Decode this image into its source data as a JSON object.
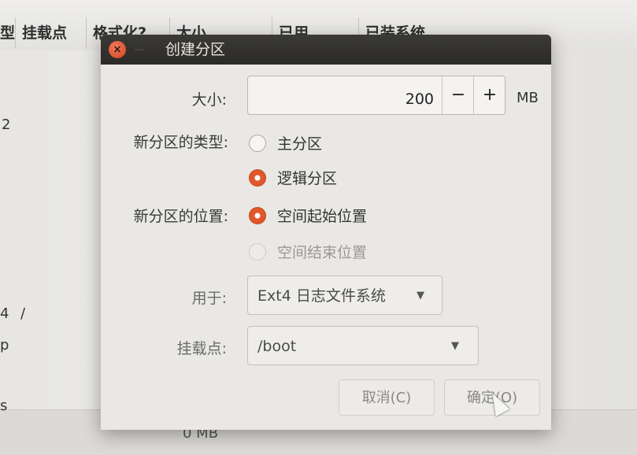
{
  "background": {
    "columns": [
      "型",
      "挂载点",
      "格式化?",
      "大小",
      "已用",
      "已装系统"
    ],
    "cells": [
      "2",
      "4",
      "/",
      "p",
      "s",
      "0 MB"
    ]
  },
  "dialog": {
    "title": "创建分区",
    "size_label": "大小:",
    "size_value": "200",
    "minus": "−",
    "plus": "+",
    "unit": "MB",
    "type_label": "新分区的类型:",
    "type_options": [
      "主分区",
      "逻辑分区"
    ],
    "type_selected": "逻辑分区",
    "location_label": "新分区的位置:",
    "location_options": [
      "空间起始位置",
      "空间结束位置"
    ],
    "location_selected": "空间起始位置",
    "use_label": "用于:",
    "use_value": "Ext4 日志文件系统",
    "mount_label": "挂载点:",
    "mount_value": "/boot",
    "cancel": "取消(C)",
    "ok": "确定(O)"
  },
  "colors": {
    "accent": "#e1572a",
    "titlebar": "#2f2e2b"
  }
}
